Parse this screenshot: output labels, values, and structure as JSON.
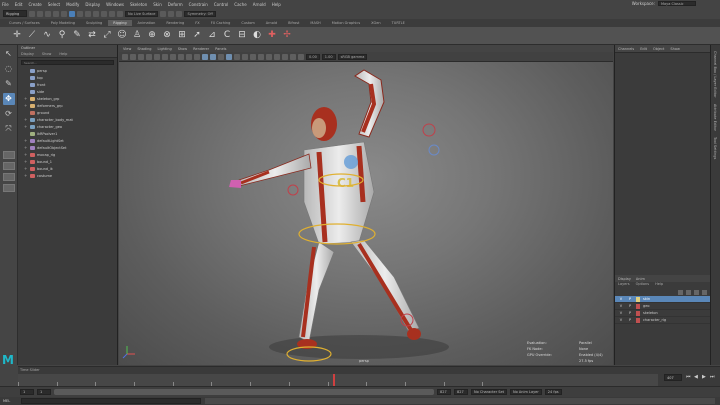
{
  "menubar": {
    "items": [
      "File",
      "Edit",
      "Create",
      "Select",
      "Modify",
      "Display",
      "Windows",
      "Skeleton",
      "Skin",
      "Deform",
      "Constrain",
      "Control",
      "Cache",
      "Arnold",
      "Help"
    ],
    "workspace_label": "Workspace:",
    "workspace_value": "Maya Classic"
  },
  "status_line": {
    "mode": "Rigging",
    "no_live_surface": "No Live Surface",
    "symmetry": "Symmetry: Off"
  },
  "shelf": {
    "tabs": [
      "Curves / Surfaces",
      "Poly Modeling",
      "Sculpting",
      "Rigging",
      "Animation",
      "Rendering",
      "FX",
      "FX Caching",
      "Custom",
      "Arnold",
      "Bifrost",
      "MASH",
      "Motion Graphics",
      "XGen",
      "TURTLE"
    ],
    "active_tab": "Rigging"
  },
  "outliner": {
    "title": "Outliner",
    "menu": [
      "Display",
      "Show",
      "Help"
    ],
    "search_placeholder": "Search...",
    "items": [
      {
        "label": "persp",
        "expandable": false,
        "color": "#8aa0c8"
      },
      {
        "label": "top",
        "expandable": false,
        "color": "#8aa0c8"
      },
      {
        "label": "front",
        "expandable": false,
        "color": "#8aa0c8"
      },
      {
        "label": "side",
        "expandable": false,
        "color": "#8aa0c8"
      },
      {
        "label": "skeleton_grp",
        "expandable": true,
        "color": "#d8b070"
      },
      {
        "label": "deformers_grp",
        "expandable": true,
        "color": "#d8b070"
      },
      {
        "label": "ground",
        "expandable": false,
        "color": "#c07060"
      },
      {
        "label": "character_body_mat",
        "expandable": true,
        "color": "#7aa0c0"
      },
      {
        "label": "character_geo",
        "expandable": true,
        "color": "#7aa0c0"
      },
      {
        "label": "ikRPsolver1",
        "expandable": false,
        "color": "#a0b080"
      },
      {
        "label": "defaultLightSet",
        "expandable": true,
        "color": "#a080c0"
      },
      {
        "label": "defaultObjectSet",
        "expandable": true,
        "color": "#a080c0"
      },
      {
        "label": "mocap_rig",
        "expandable": true,
        "color": "#d06060"
      },
      {
        "label": "bound_1",
        "expandable": true,
        "color": "#d06060"
      },
      {
        "label": "bound_ik",
        "expandable": true,
        "color": "#d06060"
      },
      {
        "label": "costume",
        "expandable": true,
        "color": "#d06060"
      }
    ]
  },
  "viewport": {
    "menu": [
      "View",
      "Shading",
      "Lighting",
      "Show",
      "Renderer",
      "Panels"
    ],
    "color_space": "sRGB gamma",
    "exposure": "0.00",
    "gamma": "1.00",
    "camera": "persp",
    "hud": [
      {
        "k": "Evaluation:",
        "v": "Parallel"
      },
      {
        "k": "FK Node:",
        "v": "None"
      },
      {
        "k": "GPU Override:",
        "v": "Enabled (4/4)"
      }
    ],
    "fps": "27.5 fps"
  },
  "channel_box": {
    "tabs": [
      "Channels",
      "Edit",
      "Object",
      "Show"
    ],
    "layer_tabs": [
      "Display",
      "Anim"
    ],
    "layer_menu": [
      "Layers",
      "Options",
      "Help"
    ],
    "layers": [
      {
        "v": "V",
        "p": "P",
        "label": "skin",
        "selected": true,
        "color": "#e0d080"
      },
      {
        "v": "V",
        "p": "P",
        "label": "geo",
        "selected": false,
        "color": "#c05050"
      },
      {
        "v": "V",
        "p": "P",
        "label": "skeleton",
        "selected": false,
        "color": "#c05050"
      },
      {
        "v": "V",
        "p": "P",
        "label": "character_rig",
        "selected": false,
        "color": "#c05050"
      }
    ],
    "side_tabs": [
      "Channel Box / Layer Editor",
      "Attribute Editor",
      "Tool Settings"
    ]
  },
  "time_slider": {
    "label": "Time Slider",
    "current_frame": "407",
    "ticks": [
      0,
      50,
      100,
      150,
      200,
      250,
      300,
      350,
      400,
      450,
      500,
      550,
      600
    ]
  },
  "range_slider": {
    "start": "1",
    "start_range": "1",
    "end_range": "827",
    "end": "827",
    "character_set": "No Character Set",
    "anim_layer": "No Anim Layer",
    "fps_setting": "24 fps"
  },
  "command_line": {
    "language": "MEL"
  }
}
